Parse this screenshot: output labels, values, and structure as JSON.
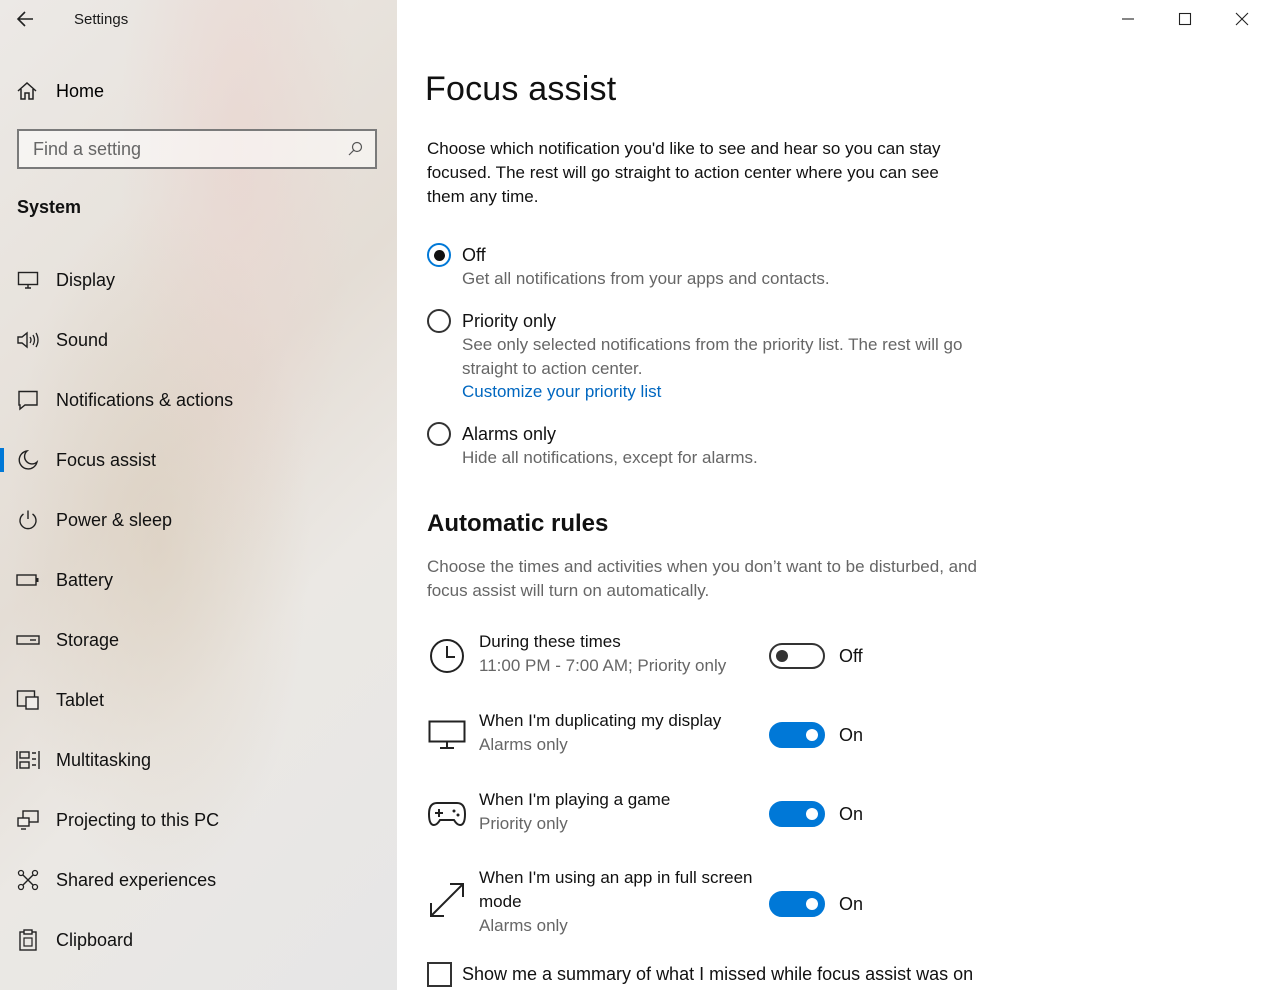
{
  "window": {
    "app_title": "Settings",
    "controls": {
      "minimize": "minimize-icon",
      "maximize": "maximize-icon",
      "close": "close-icon"
    }
  },
  "sidebar": {
    "home_label": "Home",
    "search": {
      "placeholder": "Find a setting",
      "value": ""
    },
    "section": "System",
    "items": [
      {
        "label": "Display",
        "icon": "display-icon"
      },
      {
        "label": "Sound",
        "icon": "sound-icon"
      },
      {
        "label": "Notifications & actions",
        "icon": "notifications-icon"
      },
      {
        "label": "Focus assist",
        "icon": "moon-icon",
        "active": true
      },
      {
        "label": "Power & sleep",
        "icon": "power-icon"
      },
      {
        "label": "Battery",
        "icon": "battery-icon"
      },
      {
        "label": "Storage",
        "icon": "storage-icon"
      },
      {
        "label": "Tablet",
        "icon": "tablet-icon"
      },
      {
        "label": "Multitasking",
        "icon": "multitasking-icon"
      },
      {
        "label": "Projecting to this PC",
        "icon": "projecting-icon"
      },
      {
        "label": "Shared experiences",
        "icon": "shared-experiences-icon"
      },
      {
        "label": "Clipboard",
        "icon": "clipboard-icon"
      }
    ]
  },
  "main": {
    "title": "Focus assist",
    "intro": "Choose which notification you'd like to see and hear so you can stay focused. The rest will go straight to action center where you can see them any time.",
    "modes": [
      {
        "label": "Off",
        "desc": "Get all notifications from your apps and contacts.",
        "selected": true
      },
      {
        "label": "Priority only",
        "desc": "See only selected notifications from the priority list. The rest will go straight to action center.",
        "link": "Customize your priority list",
        "selected": false
      },
      {
        "label": "Alarms only",
        "desc": "Hide all notifications, except for alarms.",
        "selected": false
      }
    ],
    "automatic_rules": {
      "title": "Automatic rules",
      "desc": "Choose the times and activities when you don’t want to be disturbed, and focus assist will turn on automatically.",
      "rules": [
        {
          "title": "During these times",
          "sub": "11:00 PM - 7:00 AM; Priority only",
          "state": "Off",
          "icon": "clock-icon"
        },
        {
          "title": "When I'm duplicating my display",
          "sub": "Alarms only",
          "state": "On",
          "icon": "monitor-icon"
        },
        {
          "title": "When I'm playing a game",
          "sub": "Priority only",
          "state": "On",
          "icon": "gamepad-icon"
        },
        {
          "title": "When I'm using an app in full screen mode",
          "sub": "Alarms only",
          "state": "On",
          "icon": "fullscreen-icon"
        }
      ]
    },
    "summary_checkbox": {
      "label": "Show me a summary of what I missed while focus assist was on",
      "checked": false
    }
  },
  "colors": {
    "accent": "#0078d7",
    "link": "#0067c0",
    "secondary_text": "#666666"
  }
}
